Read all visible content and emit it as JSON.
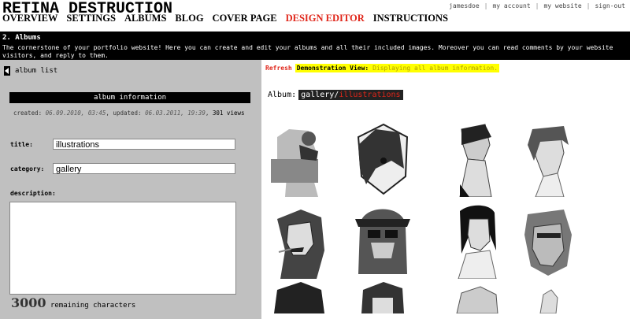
{
  "header": {
    "logo": "RETINA DESTRUCTION",
    "nav": [
      "OVERVIEW",
      "SETTINGS",
      "ALBUMS",
      "BLOG",
      "COVER PAGE",
      "DESIGN EDITOR",
      "INSTRUCTIONS"
    ],
    "active_nav": "DESIGN EDITOR",
    "account": {
      "user": "jamesdoe",
      "my_account": "my account",
      "my_website": "my website",
      "sign_out": "sign-out"
    }
  },
  "section": {
    "title": "2. Albums",
    "description": "The cornerstone of your portfolio website! Here you can create and edit your albums and all their included images. Moreover you can read comments by your website visitors, and reply to them."
  },
  "left": {
    "back_label": "album list",
    "info_header": "album information",
    "meta": {
      "created_label": "created:",
      "created": "06.09.2010, 03:45",
      "updated_label": "updated:",
      "updated": "06.03.2011, 19:39",
      "views": "301 views"
    },
    "title_label": "title:",
    "title_value": "illustrations",
    "category_label": "category:",
    "category_value": "gallery",
    "description_label": "description:",
    "description_value": "",
    "remaining_count": "3000",
    "remaining_label": "remaining characters"
  },
  "right": {
    "refresh_label": "Refresh",
    "demo_label": "Demonstration View:",
    "demo_text": "Displaying all album information.",
    "album_label": "Album:",
    "album_parent": "gallery",
    "album_name": "illustrations",
    "thumbnails": [
      "portrait-thumb",
      "portrait-thumb",
      "portrait-thumb",
      "portrait-thumb",
      "portrait-thumb",
      "portrait-thumb",
      "portrait-thumb",
      "portrait-thumb",
      "portrait-thumb",
      "portrait-thumb",
      "portrait-thumb",
      "portrait-thumb"
    ]
  },
  "colors": {
    "accent": "#e0261a",
    "highlight": "#ffff00",
    "panel": "#c0c0c0"
  }
}
